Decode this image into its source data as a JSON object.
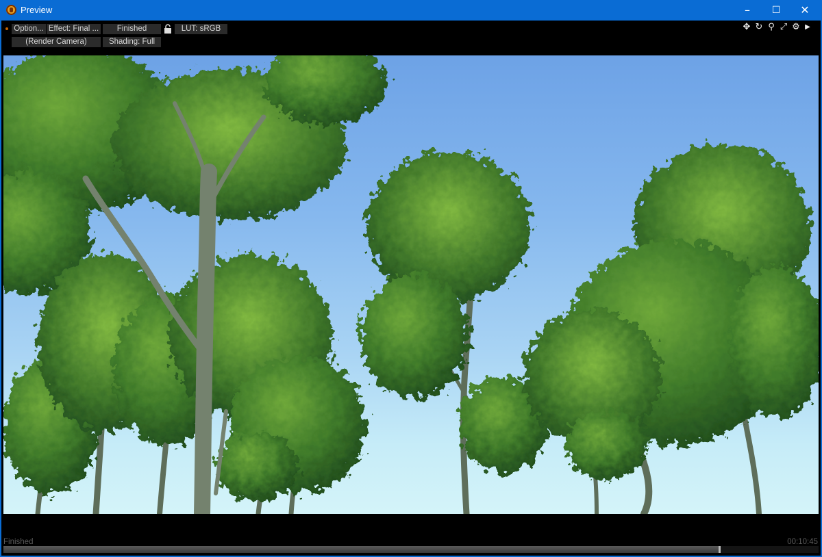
{
  "window": {
    "title": "Preview"
  },
  "toolbar": {
    "options_label": "Option...",
    "effect_label": "Effect: Final ...",
    "status_label": "Finished",
    "lut_label": "LUT: sRGB",
    "camera_label": "(Render Camera)",
    "shading_label": "Shading: Full"
  },
  "icons": [
    "move-icon",
    "rotate-icon",
    "zoom-icon",
    "fit-icon",
    "settings-icon",
    "play-icon",
    "lock-icon"
  ],
  "status": {
    "text": "Finished",
    "elapsed": "00:10:45",
    "progress_fraction": 0.88
  },
  "colors": {
    "titlebar": "#0a6cd4",
    "sky_top": "#6da2e6",
    "sky_bottom": "#d4f4f9",
    "foliage": "#3f7a2a"
  }
}
